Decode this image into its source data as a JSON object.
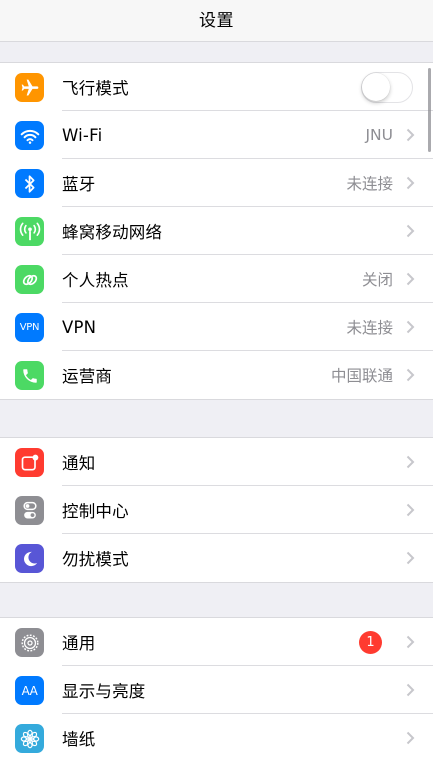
{
  "header": {
    "title": "设置"
  },
  "colors": {
    "orange": "#ff9500",
    "blue": "#007aff",
    "green": "#4cd964",
    "red": "#ff3b30",
    "gray": "#8e8e93",
    "purple": "#5856d6"
  },
  "group1": {
    "airplane": {
      "label": "飞行模式",
      "toggle_on": false,
      "icon": "airplane-icon"
    },
    "wifi": {
      "label": "Wi-Fi",
      "value": "JNU",
      "icon": "wifi-icon"
    },
    "bluetooth": {
      "label": "蓝牙",
      "value": "未连接",
      "icon": "bluetooth-icon"
    },
    "cellular": {
      "label": "蜂窝移动网络",
      "icon": "cellular-antenna-icon"
    },
    "hotspot": {
      "label": "个人热点",
      "value": "关闭",
      "icon": "hotspot-icon"
    },
    "vpn": {
      "label": "VPN",
      "value": "未连接",
      "icon": "vpn-icon",
      "icon_text": "VPN"
    },
    "carrier": {
      "label": "运营商",
      "value": "中国联通",
      "icon": "phone-icon"
    }
  },
  "group2": {
    "notifications": {
      "label": "通知",
      "icon": "notifications-icon"
    },
    "control_center": {
      "label": "控制中心",
      "icon": "control-center-icon"
    },
    "dnd": {
      "label": "勿扰模式",
      "icon": "moon-icon"
    }
  },
  "group3": {
    "general": {
      "label": "通用",
      "badge": "1",
      "icon": "gear-icon"
    },
    "display": {
      "label": "显示与亮度",
      "icon": "display-brightness-icon",
      "icon_text": "AA"
    },
    "wallpaper": {
      "label": "墙纸",
      "icon": "wallpaper-flower-icon"
    }
  }
}
